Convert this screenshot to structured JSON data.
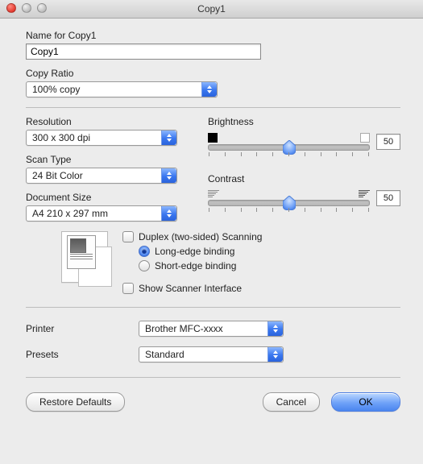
{
  "window": {
    "title": "Copy1"
  },
  "name_section": {
    "label": "Name for Copy1",
    "value": "Copy1"
  },
  "copy_ratio": {
    "label": "Copy Ratio",
    "value": "100% copy"
  },
  "resolution": {
    "label": "Resolution",
    "value": "300 x 300 dpi"
  },
  "scan_type": {
    "label": "Scan Type",
    "value": "24 Bit Color"
  },
  "document_size": {
    "label": "Document Size",
    "value": "A4  210 x 297 mm"
  },
  "brightness": {
    "label": "Brightness",
    "value": "50",
    "percent": 50
  },
  "contrast": {
    "label": "Contrast",
    "value": "50",
    "percent": 50
  },
  "duplex": {
    "label": "Duplex (two-sided) Scanning",
    "long_edge": "Long-edge binding",
    "short_edge": "Short-edge binding"
  },
  "show_scanner_interface": {
    "label": "Show Scanner Interface"
  },
  "printer": {
    "label": "Printer",
    "value": "Brother MFC-xxxx"
  },
  "presets": {
    "label": "Presets",
    "value": "Standard"
  },
  "buttons": {
    "restore": "Restore Defaults",
    "cancel": "Cancel",
    "ok": "OK"
  }
}
